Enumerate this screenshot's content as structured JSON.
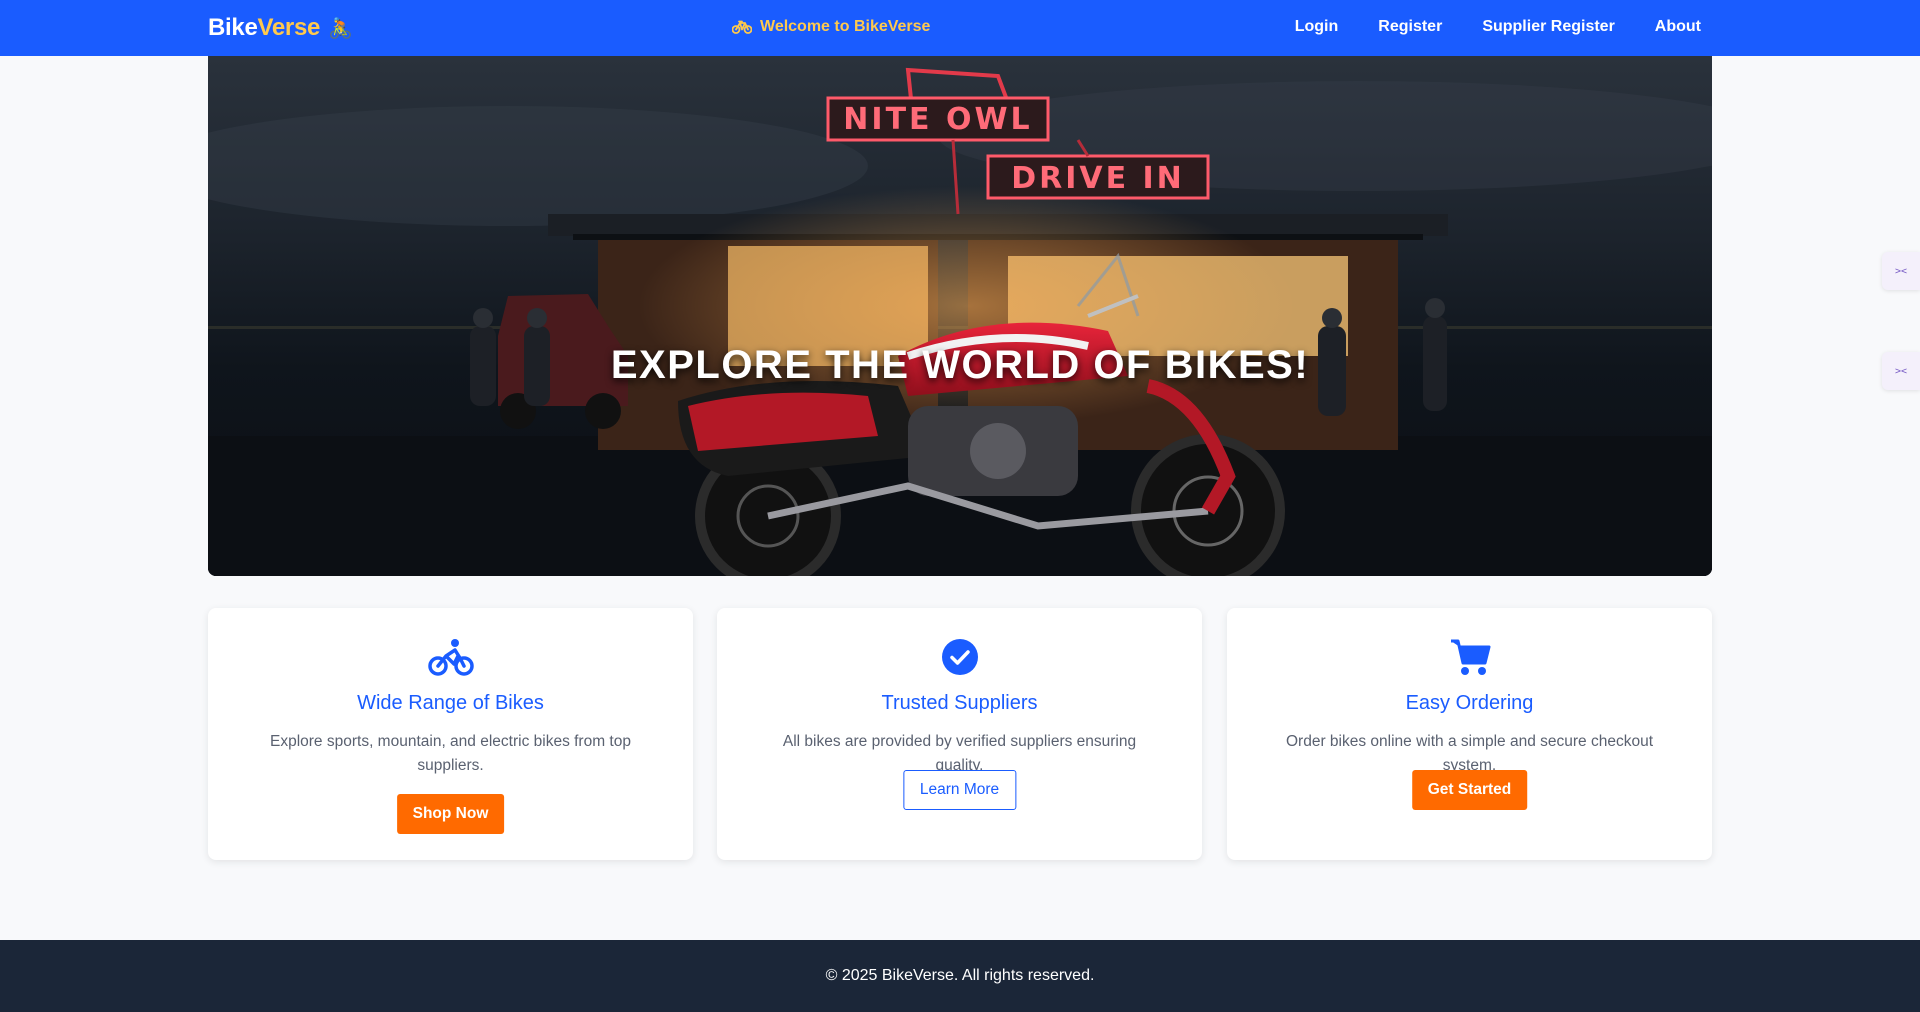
{
  "navbar": {
    "brand_main": "Bike",
    "brand_accent": "Verse",
    "brand_emoji": "🚴",
    "welcome_text": "Welcome to BikeVerse",
    "links": [
      "Login",
      "Register",
      "Supplier Register",
      "About"
    ]
  },
  "hero": {
    "title": "EXPLORE THE WORLD OF BIKES!",
    "sign_top": "NITE OWL",
    "sign_bottom": "DRIVE IN"
  },
  "features": [
    {
      "icon": "motorcycle-icon",
      "title": "Wide Range of Bikes",
      "text": "Explore sports, mountain, and electric bikes from top suppliers.",
      "button": "Shop Now"
    },
    {
      "icon": "check-circle-icon",
      "title": "Trusted Suppliers",
      "text": "All bikes are provided by verified suppliers ensuring quality.",
      "button": "Learn More"
    },
    {
      "icon": "cart-icon",
      "title": "Easy Ordering",
      "text": "Order bikes online with a simple and secure checkout system.",
      "button": "Get Started"
    }
  ],
  "footer": {
    "text": "© 2025 BikeVerse. All rights reserved."
  },
  "colors": {
    "primary": "#1a5cff",
    "accent": "#ffc94d",
    "cta": "#ff6a00",
    "footer_bg": "#1b2638"
  }
}
